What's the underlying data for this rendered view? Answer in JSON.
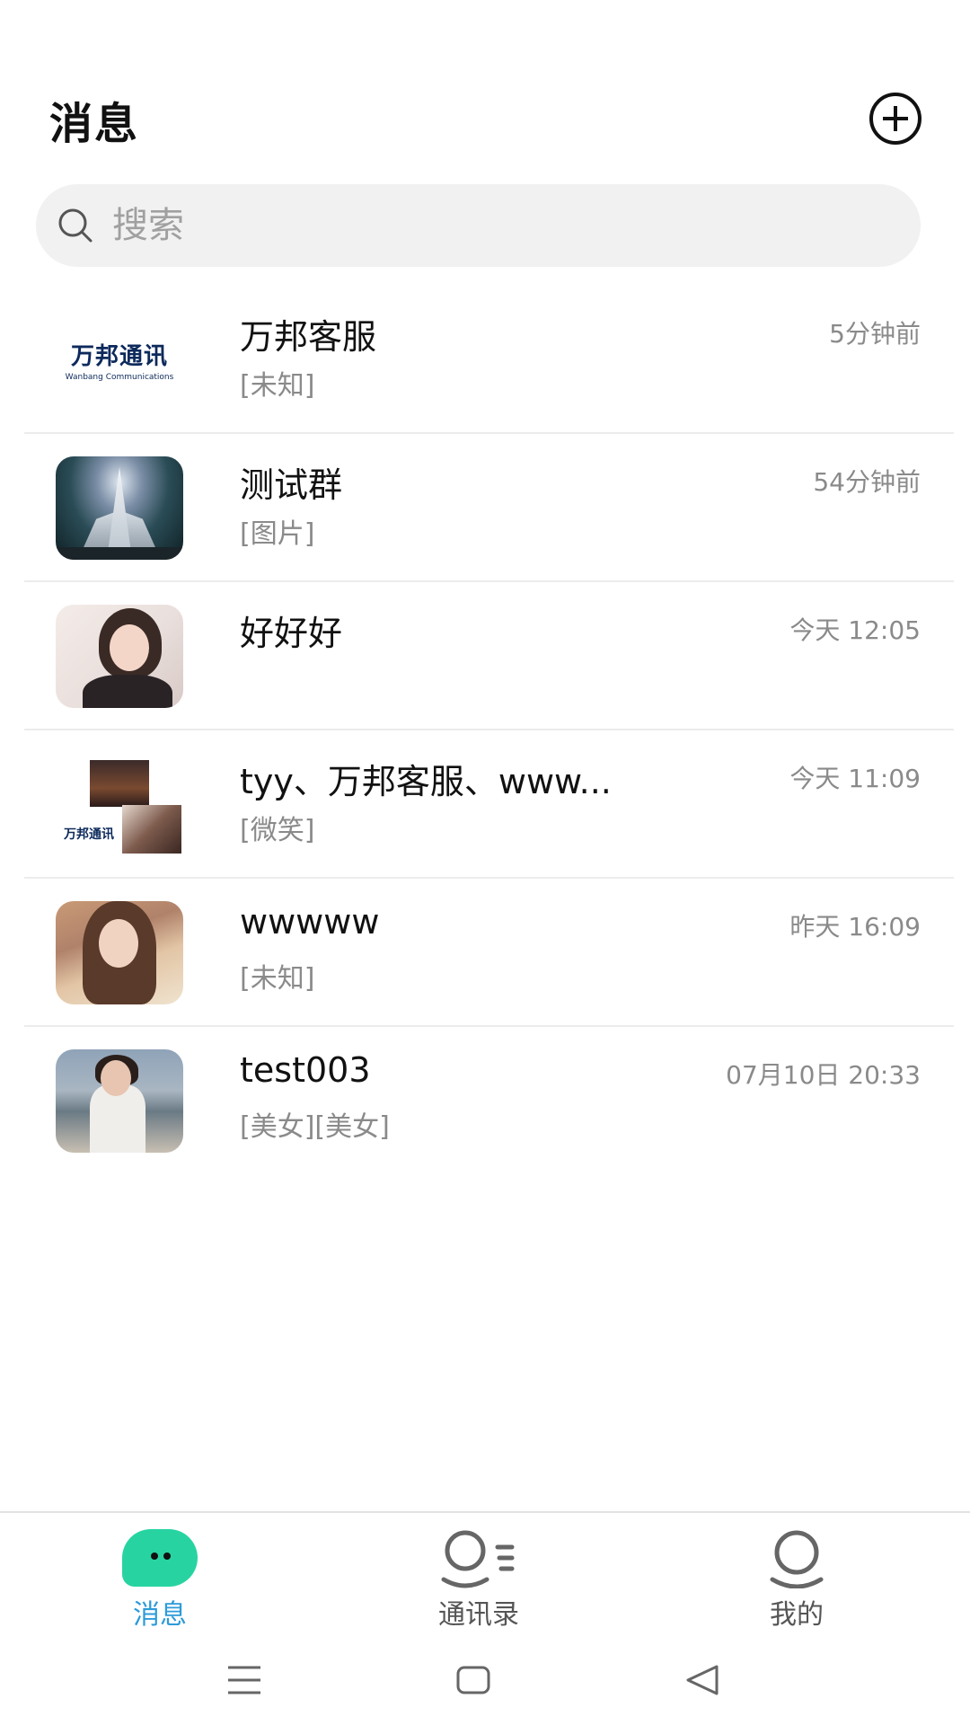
{
  "header": {
    "title": "消息",
    "add_icon": "plus-circle-icon"
  },
  "search": {
    "placeholder": "搜索",
    "icon": "search-icon"
  },
  "conversations": [
    {
      "name": "万邦客服",
      "time": "5分钟前",
      "preview": "[未知]",
      "avatar": "logo",
      "avatar_logo_text": "万邦通讯",
      "avatar_logo_subtext": "Wanbang Communications"
    },
    {
      "name": "测试群",
      "time": "54分钟前",
      "preview": "[图片]",
      "avatar": "church-photo"
    },
    {
      "name": "好好好",
      "time": "今天 12:05",
      "preview": "",
      "avatar": "portrait-photo"
    },
    {
      "name": "tyy、万邦客服、www...",
      "time": "今天 11:09",
      "preview": "[微笑]",
      "avatar": "group-collage",
      "avatar_logo_text": "万邦通讯"
    },
    {
      "name": "wwwww",
      "time": "昨天 16:09",
      "preview": "[未知]",
      "avatar": "portrait-photo"
    },
    {
      "name": "test003",
      "time": "07月10日 20:33",
      "preview": "[美女][美女]",
      "avatar": "beach-photo"
    }
  ],
  "tabbar": {
    "tabs": [
      {
        "label": "消息",
        "icon": "chat-bubble-icon",
        "active": true
      },
      {
        "label": "通讯录",
        "icon": "contacts-icon",
        "active": false
      },
      {
        "label": "我的",
        "icon": "profile-icon",
        "active": false
      }
    ],
    "active_color": "#2d9bd8",
    "chat_icon_color": "#27d4a1"
  },
  "system_nav": {
    "buttons": [
      "menu-icon",
      "home-icon",
      "back-icon"
    ]
  }
}
